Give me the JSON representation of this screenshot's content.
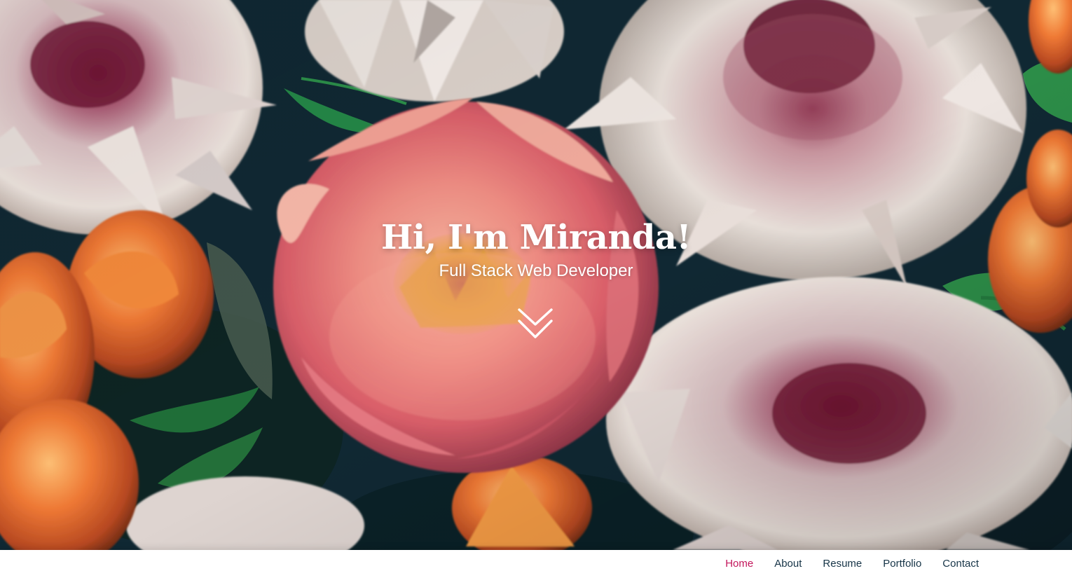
{
  "hero": {
    "title": "Hi, I'm Miranda!",
    "subtitle": "Full Stack Web Developer",
    "scroll_icon": "double-chevron-down-icon",
    "background_image": "floral photograph with pink peony, pale dahlias and orange tulips"
  },
  "navbar": {
    "items": [
      {
        "label": "Home",
        "active": true
      },
      {
        "label": "About",
        "active": false
      },
      {
        "label": "Resume",
        "active": false
      },
      {
        "label": "Portfolio",
        "active": false
      },
      {
        "label": "Contact",
        "active": false
      }
    ]
  },
  "colors": {
    "active_link": "#c3165b",
    "nav_link": "#163447",
    "hero_text": "#ffffff",
    "navbar_background": "#ffffff"
  }
}
